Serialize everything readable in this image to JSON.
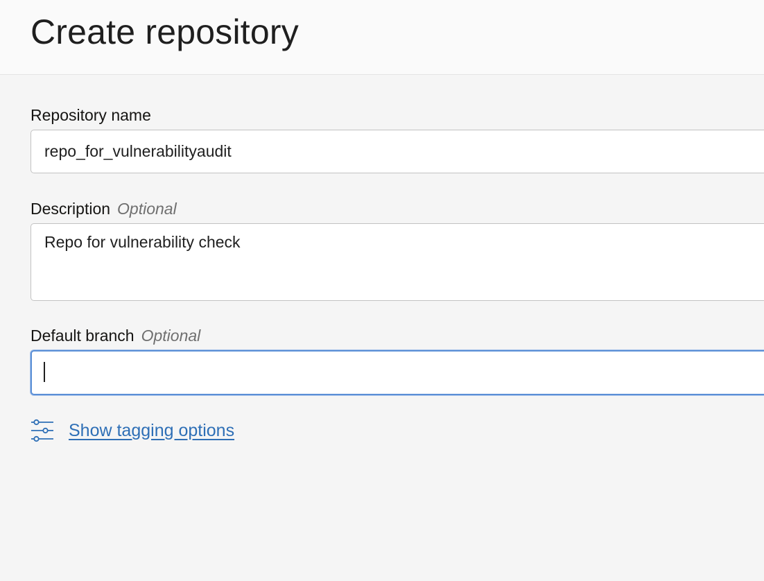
{
  "header": {
    "title": "Create repository"
  },
  "form": {
    "repository_name": {
      "label": "Repository name",
      "value": "repo_for_vulnerabilityaudit"
    },
    "description": {
      "label": "Description",
      "optional": "Optional",
      "value": "Repo for vulnerability check"
    },
    "default_branch": {
      "label": "Default branch",
      "optional": "Optional",
      "value": ""
    },
    "tagging": {
      "icon": "sliders-icon",
      "label": "Show tagging options"
    }
  },
  "colors": {
    "link": "#2e6fb6",
    "focus_border": "#5b8fd6",
    "background": "#f5f5f5",
    "header_background": "#fafafa"
  }
}
